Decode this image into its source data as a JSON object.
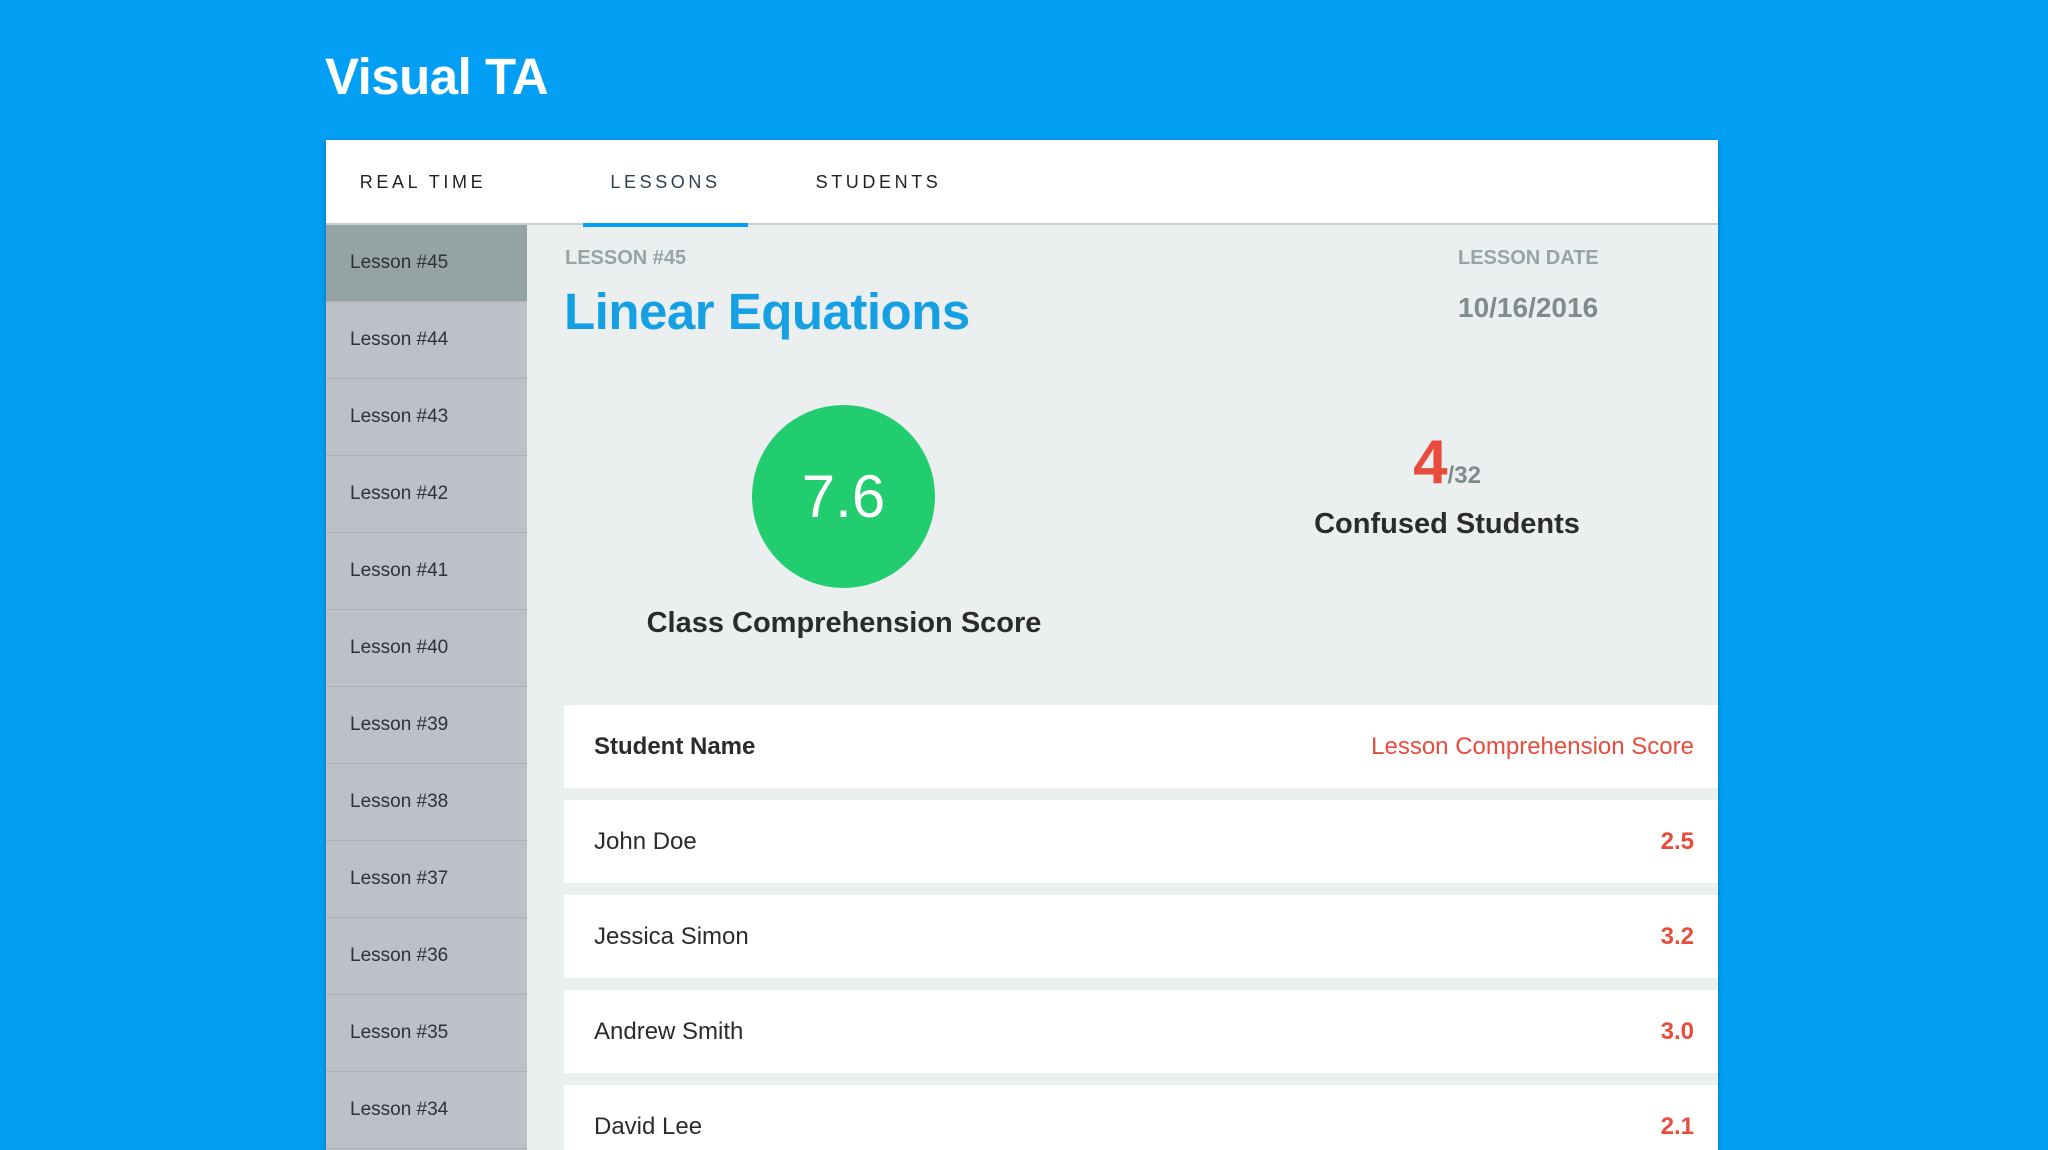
{
  "app": {
    "title": "Visual TA"
  },
  "colors": {
    "accent": "#039ff4",
    "good": "#21cd6e",
    "alert": "#e84c3d"
  },
  "tabs": [
    {
      "label": "REAL TIME",
      "active": false
    },
    {
      "label": "LESSONS",
      "active": true
    },
    {
      "label": "STUDENTS",
      "active": false
    }
  ],
  "sidebar": {
    "items": [
      {
        "label": "Lesson #45",
        "active": true
      },
      {
        "label": "Lesson #44"
      },
      {
        "label": "Lesson #43"
      },
      {
        "label": "Lesson #42"
      },
      {
        "label": "Lesson #41"
      },
      {
        "label": "Lesson #40"
      },
      {
        "label": "Lesson #39"
      },
      {
        "label": "Lesson #38"
      },
      {
        "label": "Lesson #37"
      },
      {
        "label": "Lesson #36"
      },
      {
        "label": "Lesson #35"
      },
      {
        "label": "Lesson #34"
      }
    ]
  },
  "lesson": {
    "label": "LESSON #45",
    "title": "Linear Equations",
    "date_label": "LESSON DATE",
    "date": "10/16/2016",
    "comprehension_score": "7.6",
    "comprehension_caption": "Class Comprehension Score",
    "confused_count": "4",
    "confused_total": "/32",
    "confused_caption": "Confused Students"
  },
  "table": {
    "headers": {
      "name": "Student Name",
      "score": "Lesson Comprehension Score"
    },
    "rows": [
      {
        "name": "John Doe",
        "score": "2.5"
      },
      {
        "name": "Jessica Simon",
        "score": "3.2"
      },
      {
        "name": "Andrew Smith",
        "score": "3.0"
      },
      {
        "name": "David Lee",
        "score": "2.1"
      }
    ]
  }
}
